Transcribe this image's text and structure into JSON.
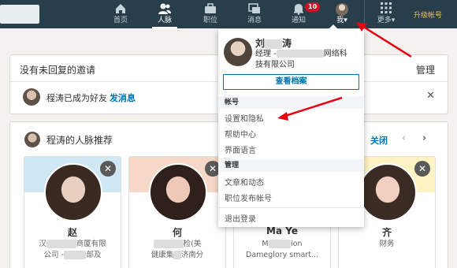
{
  "nav": {
    "items": [
      {
        "label": "首页",
        "icon": "home-icon"
      },
      {
        "label": "人脉",
        "icon": "people-icon"
      },
      {
        "label": "职位",
        "icon": "briefcase-icon"
      },
      {
        "label": "消息",
        "icon": "message-icon"
      },
      {
        "label": "通知",
        "icon": "bell-icon",
        "badge": "10"
      },
      {
        "label": "我",
        "icon": "avatar"
      },
      {
        "label": "更多",
        "icon": "grid-icon"
      }
    ],
    "upgrade": "升级帐号",
    "me_caret": "▾",
    "more_caret": "▾"
  },
  "invites": {
    "title": "没有未回复的邀请",
    "manage": "管理",
    "friend_text": "程涛已成为好友",
    "send_message": "发消息",
    "close": "✕"
  },
  "recommend": {
    "title": "程涛的人脉推荐",
    "close_link": "关闭",
    "prev": "‹",
    "next": "›",
    "cards": [
      {
        "name": "赵",
        "line1": "汉",
        "line1b": "商厦有限",
        "line2a": "公司 -",
        "line2b": "部及"
      },
      {
        "name": "何",
        "line1": "",
        "line1b": "检(美",
        "line2a": "健康集",
        "line2b": "济南分"
      },
      {
        "name": "Ma    Ye",
        "line1": "M",
        "line1b": "ion",
        "line2a": "Dameglory smart...",
        "line2b": ""
      },
      {
        "name": "齐",
        "line1": "财务",
        "line1b": "",
        "line2a": "",
        "line2b": ""
      }
    ],
    "dismiss": "✕"
  },
  "dropdown": {
    "name_prefix": "刘",
    "name_suffix": "涛",
    "title_a": "经理 -",
    "title_b": "网络科",
    "title_c": "技有限公司",
    "view_profile": "查看档案",
    "section_account": "帐号",
    "items_account": [
      "设置和隐私",
      "帮助中心",
      "界面语言"
    ],
    "section_manage": "管理",
    "items_manage": [
      "文章和动态",
      "职位发布帐号"
    ],
    "logout": "退出登录"
  },
  "colors": {
    "nav_bg": "#283e4a",
    "link_blue": "#0073b1",
    "badge_red": "#d11124",
    "annotation_red": "#e60012"
  }
}
